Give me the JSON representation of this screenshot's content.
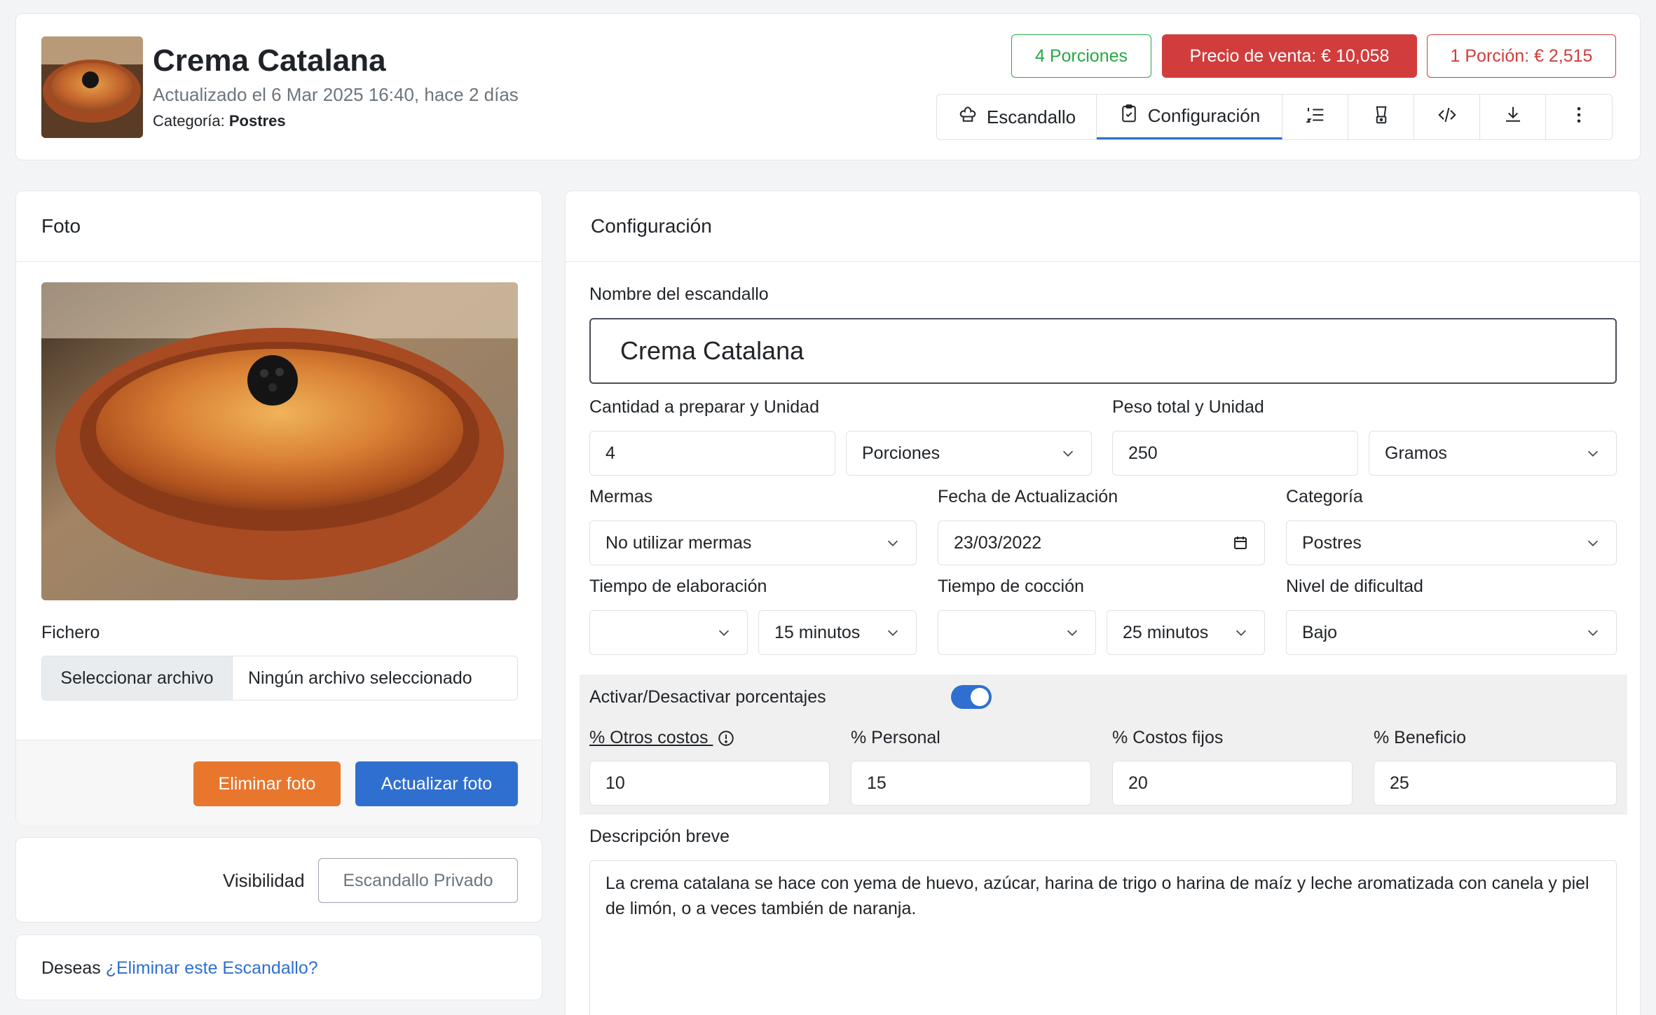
{
  "header": {
    "title": "Crema Catalana",
    "updated": "Actualizado el 6 Mar 2025 16:40, hace 2 días",
    "category_label": "Categoría:",
    "category_value": "Postres",
    "badges": {
      "portions": "4 Porciones",
      "sale_price": "Precio de venta: € 10,058",
      "portion_price": "1 Porción: € 2,515"
    },
    "tabs": [
      {
        "label": "Escandallo",
        "icon": "chef-hat-icon"
      },
      {
        "label": "Configuración",
        "icon": "clipboard-check-icon",
        "active": true
      },
      {
        "label": "",
        "icon": "ordered-list-icon"
      },
      {
        "label": "",
        "icon": "blender-icon"
      },
      {
        "label": "",
        "icon": "code-icon"
      },
      {
        "label": "",
        "icon": "download-icon"
      },
      {
        "label": "",
        "icon": "more-vertical-icon"
      }
    ]
  },
  "photo_card": {
    "title": "Foto",
    "file_label": "Fichero",
    "file_button": "Seleccionar archivo",
    "file_status": "Ningún archivo seleccionado",
    "delete_button": "Eliminar foto",
    "update_button": "Actualizar foto"
  },
  "visibility": {
    "label": "Visibilidad",
    "button": "Escandallo Privado"
  },
  "delete_card": {
    "prefix": "Deseas",
    "link": "¿Eliminar este Escandallo?"
  },
  "config": {
    "title": "Configuración",
    "name_label": "Nombre del escandallo",
    "name_value": "Crema Catalana",
    "quantity_label": "Cantidad a preparar y Unidad",
    "quantity_value": "4",
    "quantity_unit": "Porciones",
    "weight_label": "Peso total y Unidad",
    "weight_value": "250",
    "weight_unit": "Gramos",
    "mermas_label": "Mermas",
    "mermas_value": "No utilizar mermas",
    "date_label": "Fecha de Actualización",
    "date_value": "23/03/2022",
    "category_label": "Categoría",
    "category_value": "Postres",
    "prep_time_label": "Tiempo de elaboración",
    "prep_time_hours": "",
    "prep_time_minutes": "15 minutos",
    "cook_time_label": "Tiempo de cocción",
    "cook_time_hours": "",
    "cook_time_minutes": "25 minutos",
    "difficulty_label": "Nivel de dificultad",
    "difficulty_value": "Bajo",
    "percent_toggle_label": "Activar/Desactivar porcentajes",
    "percent_toggle_on": true,
    "other_costs_label": "% Otros costos",
    "other_costs_value": "10",
    "staff_label": "% Personal",
    "staff_value": "15",
    "fixed_costs_label": "% Costos fijos",
    "fixed_costs_value": "20",
    "profit_label": "% Beneficio",
    "profit_value": "25",
    "description_label": "Descripción breve",
    "description_value": "La crema catalana se hace con yema de huevo, azúcar, harina de trigo o harina de maíz y leche aromatizada con canela y piel de limón, o a veces también de naranja."
  },
  "colors": {
    "primary": "#2f6fd0",
    "danger": "#d13d3d",
    "success": "#27a844",
    "warning": "#e8762c"
  }
}
